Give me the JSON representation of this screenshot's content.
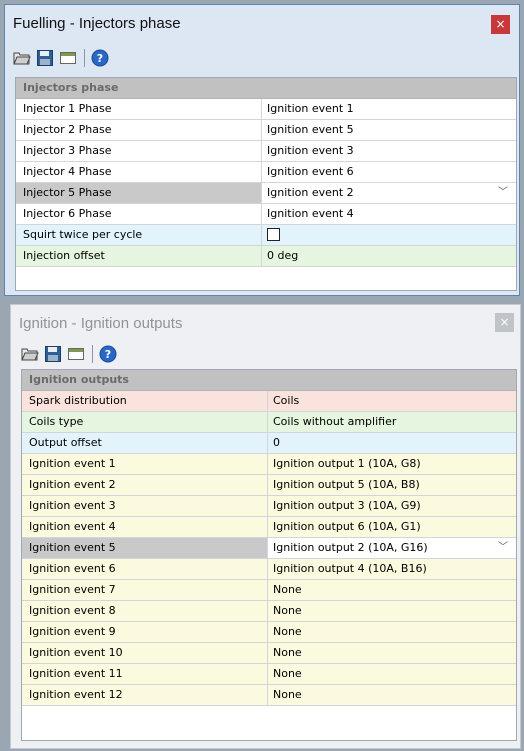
{
  "win1": {
    "title": "Fuelling - Injectors phase",
    "close_glyph": "×",
    "section": "Injectors phase",
    "rows": [
      {
        "label": "Injector 1 Phase",
        "value": "Ignition event 1"
      },
      {
        "label": "Injector 2 Phase",
        "value": "Ignition event 5"
      },
      {
        "label": "Injector 3 Phase",
        "value": "Ignition event 3"
      },
      {
        "label": "Injector 4 Phase",
        "value": "Ignition event 6"
      },
      {
        "label": "Injector 5 Phase",
        "value": "Ignition event 2"
      },
      {
        "label": "Injector 6 Phase",
        "value": "Ignition event 4"
      },
      {
        "label": "Squirt twice per cycle",
        "value": ""
      },
      {
        "label": "Injection offset",
        "value": "0 deg"
      }
    ],
    "selected_row": 4,
    "squirt_twice_checked": false
  },
  "win2": {
    "title": "Ignition - Ignition outputs",
    "close_glyph": "×",
    "section": "Ignition outputs",
    "rows": [
      {
        "label": "Spark distribution",
        "value": "Coils"
      },
      {
        "label": "Coils type",
        "value": "Coils without amplifier"
      },
      {
        "label": "Output offset",
        "value": "0"
      },
      {
        "label": "Ignition event 1",
        "value": "Ignition output 1 (10A, G8)"
      },
      {
        "label": "Ignition event 2",
        "value": "Ignition output 5 (10A, B8)"
      },
      {
        "label": "Ignition event 3",
        "value": "Ignition output 3 (10A, G9)"
      },
      {
        "label": "Ignition event 4",
        "value": "Ignition output 6 (10A, G1)"
      },
      {
        "label": "Ignition event 5",
        "value": "Ignition output 2 (10A, G16)"
      },
      {
        "label": "Ignition event 6",
        "value": "Ignition output 4 (10A, B16)"
      },
      {
        "label": "Ignition event 7",
        "value": "None"
      },
      {
        "label": "Ignition event 8",
        "value": "None"
      },
      {
        "label": "Ignition event 9",
        "value": "None"
      },
      {
        "label": "Ignition event 10",
        "value": "None"
      },
      {
        "label": "Ignition event 11",
        "value": "None"
      },
      {
        "label": "Ignition event 12",
        "value": "None"
      }
    ],
    "selected_row": 7
  },
  "toolbar_icons": [
    "open-folder-icon",
    "save-icon",
    "window-icon",
    "help-icon"
  ],
  "colors": {
    "active_border": "#5f83b0",
    "close_active": "#c8383a",
    "header_gray": "#c1c1c1",
    "row_blue": "#e3f3fb",
    "row_green": "#e6f5df",
    "row_pink": "#fbe3dd",
    "row_yellow": "#fbfadf",
    "selected_label": "#c9c9c9"
  }
}
